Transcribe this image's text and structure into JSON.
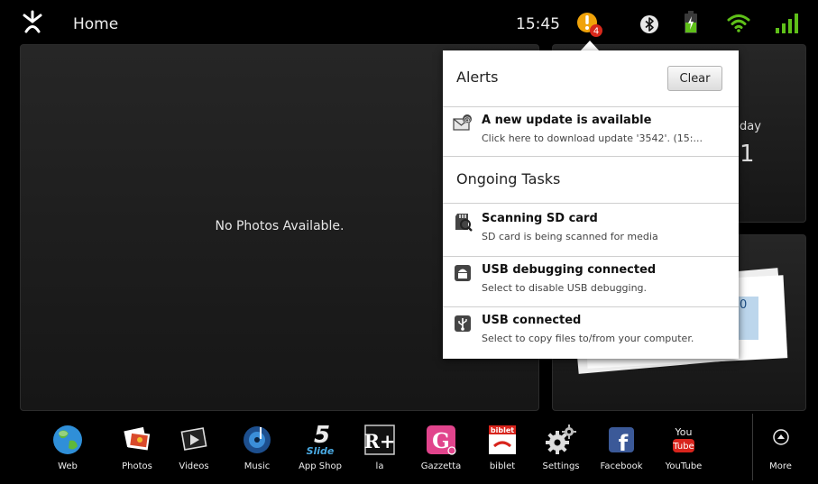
{
  "statusbar": {
    "title": "Home",
    "time": "15:45",
    "alert_count": "4",
    "accent_color": "#f0a30a"
  },
  "photos_widget": {
    "message": "No Photos Available."
  },
  "calendar_widget": {
    "day_fragment": "day",
    "date_fragment": "1"
  },
  "mail_widget": {
    "number_fragment": "0"
  },
  "notifications": {
    "alerts_title": "Alerts",
    "clear_label": "Clear",
    "alerts": [
      {
        "icon": "email-update-icon",
        "title": "A new update is available",
        "subtitle": "Click here to download update '3542'. (15:..."
      }
    ],
    "ongoing_title": "Ongoing Tasks",
    "ongoing": [
      {
        "icon": "sd-card-icon",
        "title": "Scanning SD card",
        "subtitle": "SD card is being scanned for media"
      },
      {
        "icon": "usb-debug-icon",
        "title": "USB debugging connected",
        "subtitle": "Select to disable USB debugging."
      },
      {
        "icon": "usb-icon",
        "title": "USB connected",
        "subtitle": "Select to copy files to/from your computer."
      }
    ]
  },
  "dock": {
    "apps": [
      {
        "label": "Web",
        "icon": "globe-icon"
      },
      {
        "label": "Photos",
        "icon": "photos-icon"
      },
      {
        "label": "Videos",
        "icon": "videos-icon"
      },
      {
        "label": "Music",
        "icon": "music-icon"
      },
      {
        "label": "App Shop",
        "icon": "slide-app-shop-icon",
        "icon_text": "5",
        "icon_subtext": "Slide"
      },
      {
        "label": "la",
        "icon": "r-plus-icon",
        "icon_text": "R+"
      },
      {
        "label": "Gazzetta",
        "icon": "gazzetta-icon",
        "icon_text": "G"
      },
      {
        "label": "biblet",
        "icon": "biblet-icon",
        "icon_text": "biblet"
      },
      {
        "label": "Settings",
        "icon": "settings-gear-icon"
      },
      {
        "label": "Facebook",
        "icon": "facebook-icon",
        "icon_text": "f"
      },
      {
        "label": "YouTube",
        "icon": "youtube-icon",
        "icon_text": "You",
        "icon_subtext": "Tube"
      }
    ],
    "more_label": "More"
  }
}
